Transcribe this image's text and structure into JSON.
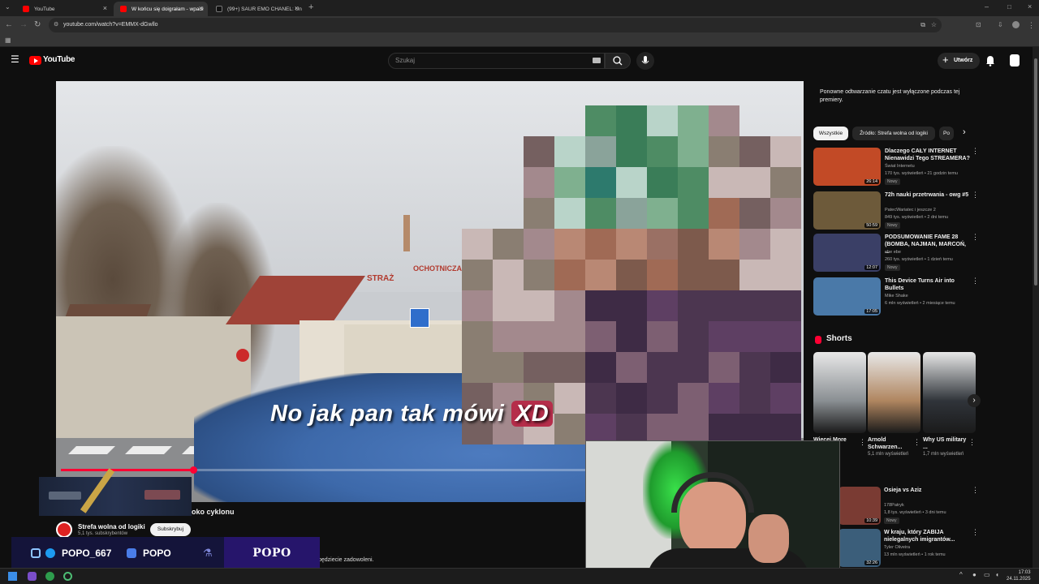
{
  "browser": {
    "tabs": [
      {
        "label": "YouTube",
        "active": false
      },
      {
        "label": "W końcu się doigrałam - wpadł",
        "active": true
      },
      {
        "label": "(99+) SAUR EMO CHANEL: Un",
        "active": false
      }
    ],
    "url": "youtube.com/watch?v=EMMX-dGwllo"
  },
  "yt": {
    "logo_text": "YouTube",
    "search_placeholder": "Szukaj",
    "create_label": "Utwórz"
  },
  "video": {
    "subtitle_main": "No jak pan tak mówi",
    "subtitle_highlight": "XD",
    "progress_fraction": 0.18,
    "title_visible": "oko cyklonu",
    "channel_name": "Strefa wolna od logiki",
    "channel_subs": "5,1 tys. subskrybentów",
    "subscribe_label": "Subskrybuj",
    "chat_snippet": "będziecie zadowoleni."
  },
  "overlay": {
    "instagram_handle": "POPO_667",
    "youtube_handle": "POPO",
    "banner_name": "POPO"
  },
  "sidebar": {
    "chat_notice": "Ponowne odtwarzanie czatu jest wyłączone podczas tej premiery.",
    "chips": [
      {
        "label": "Wszystkie",
        "selected": true
      },
      {
        "label": "Źródło: Strefa wolna od logiki",
        "selected": false
      },
      {
        "label": "Po",
        "selected": false
      }
    ],
    "recommendations": [
      {
        "title": "Dlaczego CAŁY INTERNET Nienawidzi Tego STREAMERA?",
        "channel": "Świat Internetu",
        "meta": "170 tys. wyświetleń • 21 godzin temu",
        "badge": "Nowy",
        "duration": "26:14",
        "color": "#c24a26"
      },
      {
        "title": "72h nauki przetrwania - owg #5",
        "channel": "PatecWariatec i jeszcze 2",
        "meta": "849 tys. wyświetleń • 2 dni temu",
        "badge": "Nowy",
        "duration": "50:59",
        "color": "#6d5a3a"
      },
      {
        "title": "PODSUMOWANIE FAME 28 (BOMBA, NAJMAN, MARCOŃ, ...",
        "channel": "ebe ebe",
        "meta": "260 tys. wyświetleń • 1 dzień temu",
        "badge": "Nowy",
        "duration": "12:07",
        "color": "#3a3f66"
      },
      {
        "title": "This Device Turns Air into Bullets",
        "channel": "Mike Shake",
        "meta": "6 mln wyświetleń • 2 miesiące temu",
        "badge": "",
        "duration": "17:05",
        "color": "#4a79a8"
      }
    ],
    "shorts_heading": "Shorts",
    "shorts": [
      {
        "title": "Więcej More",
        "views": "",
        "color": "#8a8f93"
      },
      {
        "title": "Arnold Schwarzen...",
        "views": "5,1 mln wyświetleń",
        "color": "#b08660"
      },
      {
        "title": "Why US military ...",
        "views": "1,7 mln wyświetleń",
        "color": "#30343a"
      }
    ],
    "more_recommendations": [
      {
        "title": "Osieja vs Aziz",
        "channel": "178Patryk",
        "meta": "1,8 tys. wyświetleń • 3 dni temu",
        "badge": "Nowy",
        "duration": "10:39",
        "color": "#7a3b33"
      },
      {
        "title": "W kraju, który ZABIJA nielegalnych imigrantów...",
        "channel": "Tyler Oliveira",
        "meta": "13 mln wyświetleń • 1 rok temu",
        "badge": "",
        "duration": "32:26",
        "color": "#3b5e7a"
      }
    ]
  },
  "taskbar": {
    "time": "17:03",
    "date": "24.11.2025"
  }
}
